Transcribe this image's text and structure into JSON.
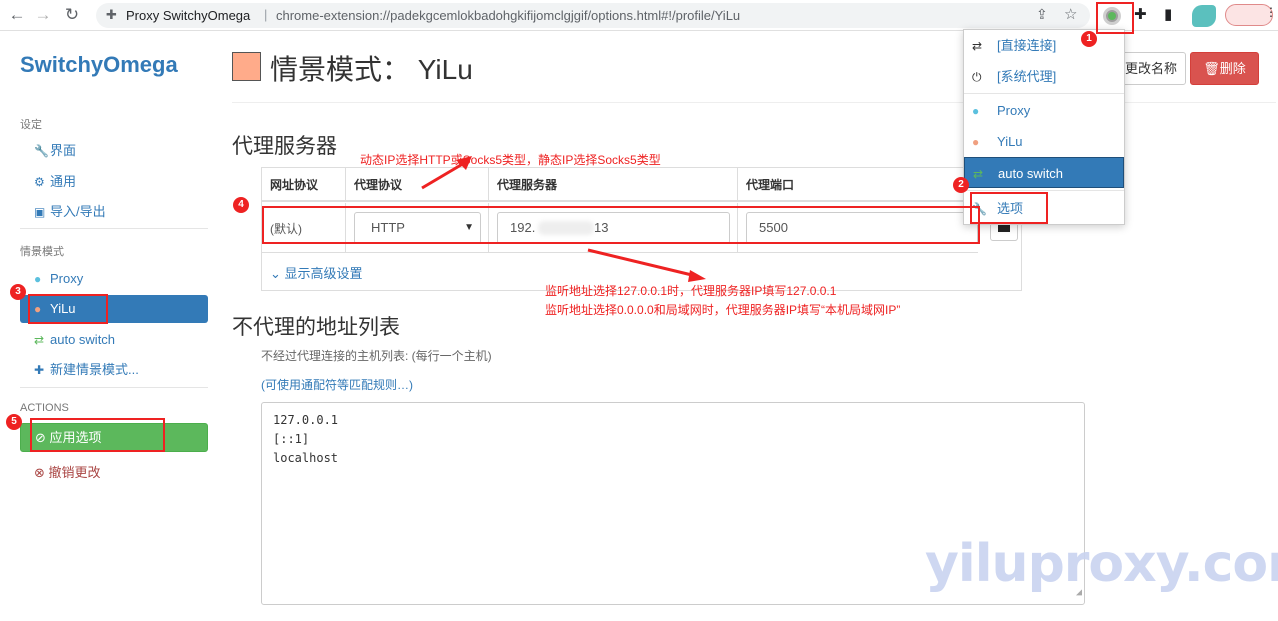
{
  "browser": {
    "site_name": "Proxy SwitchyOmega",
    "url": "chrome-extension://padekgcemlokbadohgkifijomclgjgif/options.html#!/profile/YiLu",
    "separator": "|"
  },
  "sidebar": {
    "brand": "SwitchyOmega",
    "settings_header": "设定",
    "settings_items": [
      {
        "label": "界面",
        "icon": "wrench-icon"
      },
      {
        "label": "通用",
        "icon": "gear-icon"
      },
      {
        "label": "导入/导出",
        "icon": "floppy-icon"
      }
    ],
    "profiles_header": "情景模式",
    "profile_items": [
      {
        "label": "Proxy",
        "icon": "globe-icon"
      },
      {
        "label": "YiLu",
        "icon": "globe-icon"
      },
      {
        "label": "auto switch",
        "icon": "retweet-icon"
      },
      {
        "label": "新建情景模式...",
        "icon": "plus-icon"
      }
    ],
    "actions_header": "ACTIONS",
    "apply_label": "应用选项",
    "discard_label": "撤销更改"
  },
  "main": {
    "title": "情景模式： YiLu",
    "profile_color": "#ffab8a",
    "rename_label": "更改名称",
    "delete_label": "删除",
    "proxy_section_title": "代理服务器",
    "table": {
      "headers": [
        "网址协议",
        "代理协议",
        "代理服务器",
        "代理端口"
      ],
      "row": {
        "scheme": "(默认)",
        "protocol": "HTTP",
        "server": "192.",
        "server_suffix": "13",
        "port": "5500"
      }
    },
    "advanced_label": "显示高级设置",
    "bypass_section_title": "不代理的地址列表",
    "bypass_help": "不经过代理连接的主机列表: (每行一个主机)",
    "bypass_link": "(可使用通配符等匹配规则…)",
    "bypass_list": [
      "127.0.0.1",
      "[::1]",
      "localhost"
    ]
  },
  "popup": {
    "items": [
      {
        "label": "[直接连接]",
        "icon": "arrows-icon"
      },
      {
        "label": "[系统代理]",
        "icon": "power-icon"
      },
      {
        "label": "Proxy",
        "icon": "globe-icon"
      },
      {
        "label": "YiLu",
        "icon": "globe-icon"
      },
      {
        "label": "auto switch",
        "icon": "retweet-icon"
      },
      {
        "label": "选项",
        "icon": "wrench-icon"
      }
    ]
  },
  "annotations": {
    "markers": [
      "1",
      "2",
      "3",
      "4",
      "5"
    ],
    "note_protocol": "动态IP选择HTTP或Socks5类型，静态IP选择Socks5类型",
    "note_listen_1": "监听地址选择127.0.0.1时，代理服务器IP填写127.0.0.1",
    "note_listen_2": "监听地址选择0.0.0.0和局域网时，代理服务器IP填写“本机局域网IP”",
    "watermark": "yiluproxy.com"
  },
  "colors": {
    "accent": "#337ab7",
    "apply_green": "#5cb85c",
    "delete_red": "#d9534f",
    "annotation_red": "#ee2222"
  }
}
